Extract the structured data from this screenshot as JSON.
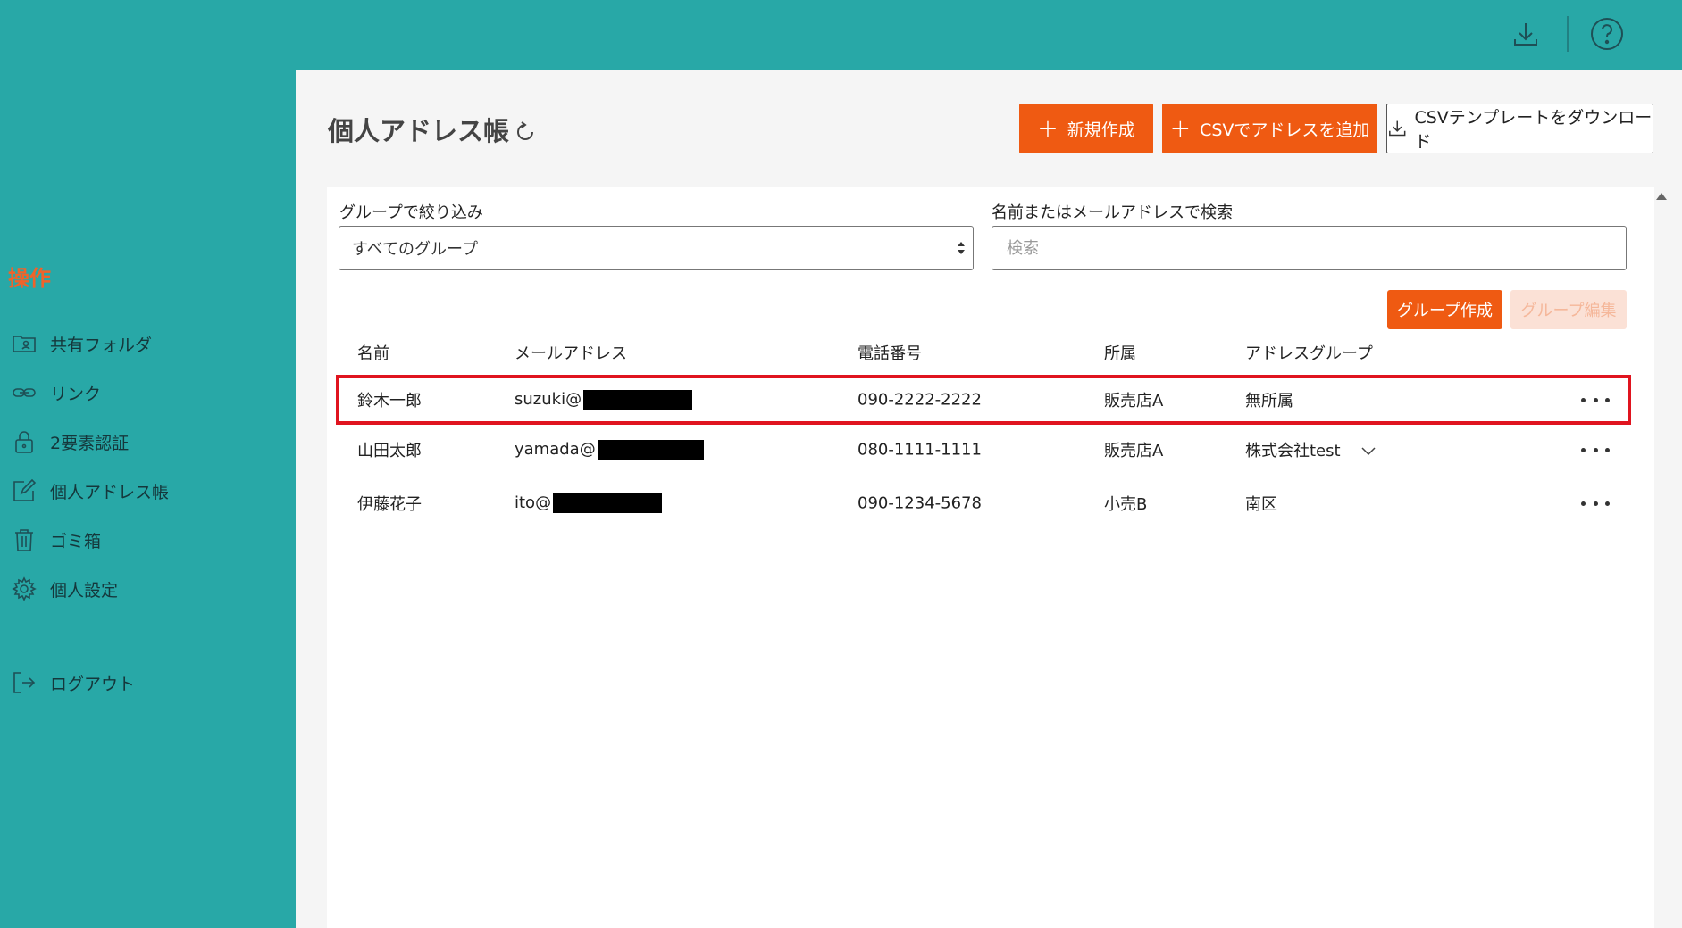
{
  "sidebar": {
    "section_title": "操作",
    "items": [
      {
        "label": "共有フォルダ",
        "icon": "folder-user-icon"
      },
      {
        "label": "リンク",
        "icon": "link-icon"
      },
      {
        "label": "2要素認証",
        "icon": "lock-icon"
      },
      {
        "label": "個人アドレス帳",
        "icon": "edit-icon"
      },
      {
        "label": "ゴミ箱",
        "icon": "trash-icon"
      },
      {
        "label": "個人設定",
        "icon": "gear-icon"
      },
      {
        "label": "ログアウト",
        "icon": "logout-icon"
      }
    ]
  },
  "header": {
    "download_icon": "download-icon",
    "help_icon": "help-icon"
  },
  "page": {
    "title": "個人アドレス帳",
    "buttons": {
      "new": "新規作成",
      "csv_add": "CSVでアドレスを追加",
      "csv_template": "CSVテンプレートをダウンロード"
    }
  },
  "filters": {
    "group_label": "グループで絞り込み",
    "group_selected": "すべてのグループ",
    "search_label": "名前またはメールアドレスで検索",
    "search_placeholder": "検索",
    "search_value": ""
  },
  "group_buttons": {
    "create": "グループ作成",
    "edit": "グループ編集"
  },
  "table": {
    "headers": [
      "名前",
      "メールアドレス",
      "電話番号",
      "所属",
      "アドレスグループ"
    ],
    "rows": [
      {
        "name": "鈴木一郎",
        "email": "suzuki@",
        "phone": "090-2222-2222",
        "affiliation": "販売店A",
        "group": "無所属",
        "highlighted": true
      },
      {
        "name": "山田太郎",
        "email": "yamada@",
        "phone": "080-1111-1111",
        "affiliation": "販売店A",
        "group": "株式会社test",
        "has_dropdown": true
      },
      {
        "name": "伊藤花子",
        "email": "ito@",
        "phone": "090-1234-5678",
        "affiliation": "小売B",
        "group": "南区"
      }
    ]
  },
  "colors": {
    "teal": "#28a8a7",
    "orange": "#ef5a12",
    "highlight_red": "#e0141f"
  }
}
